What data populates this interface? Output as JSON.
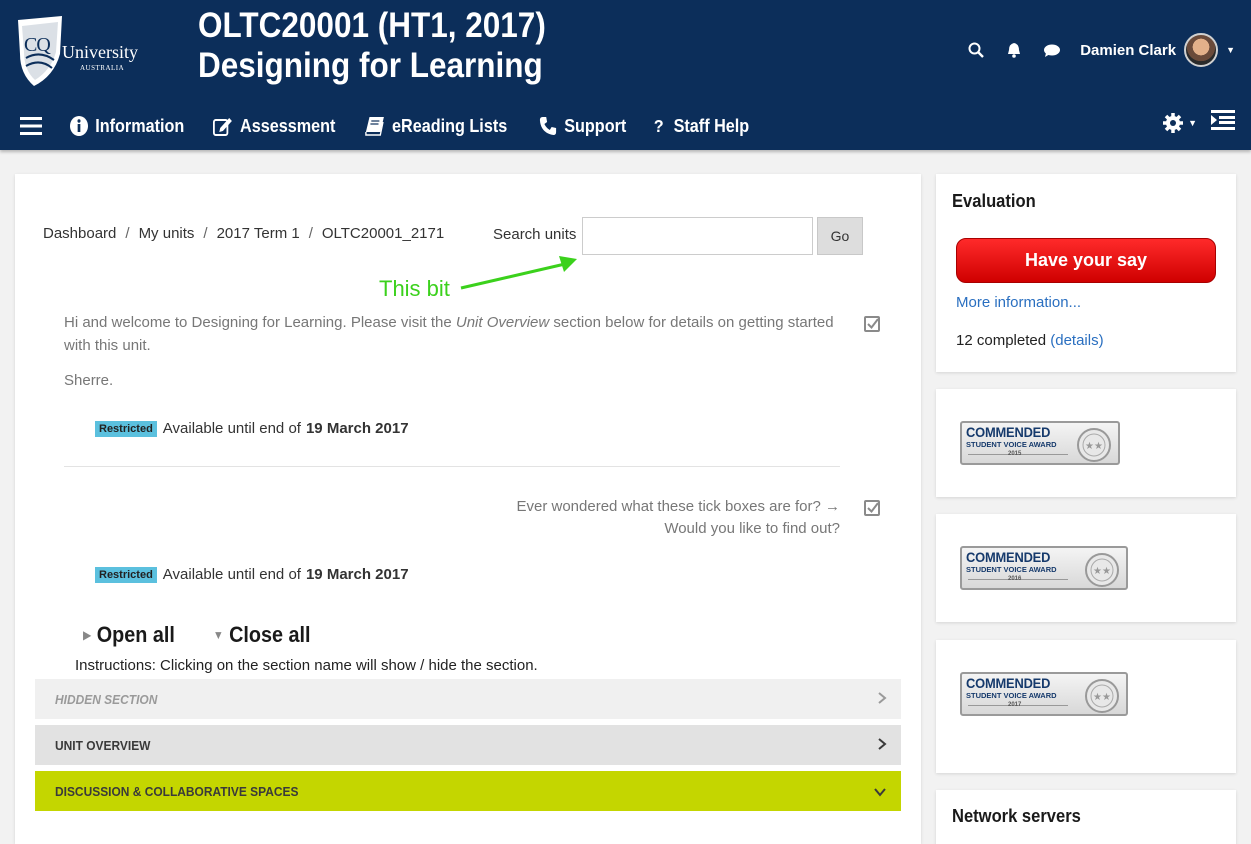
{
  "header": {
    "logo": {
      "cq": "CQ",
      "university": "University",
      "country": "AUSTRALIA"
    },
    "course_code": "OLTC20001 (HT1, 2017)",
    "course_title": "Designing for Learning",
    "user_name": "Damien Clark"
  },
  "nav": {
    "items": [
      {
        "label": "Information",
        "icon": "info-icon"
      },
      {
        "label": "Assessment",
        "icon": "edit-icon"
      },
      {
        "label": "eReading Lists",
        "icon": "book-icon"
      },
      {
        "label": "Support",
        "icon": "phone-icon"
      },
      {
        "label": "Staff Help",
        "icon": "question-icon"
      }
    ]
  },
  "breadcrumb": {
    "items": [
      "Dashboard",
      "My units",
      "2017 Term 1",
      "OLTC20001_2171"
    ],
    "separator": "/"
  },
  "search": {
    "label": "Search units",
    "value": "",
    "placeholder": "",
    "button": "Go"
  },
  "annotation": {
    "text": "This bit",
    "color": "#3bd11c"
  },
  "welcome": {
    "text_before": "Hi and welcome to Designing for Learning.  Please visit the ",
    "text_emphasis": "Unit Overview",
    "text_after": " section below for details on getting started with this unit.",
    "signoff": "Sherre."
  },
  "restrictions": [
    {
      "badge": "Restricted",
      "text": "Available until end of",
      "date": "19 March 2017"
    },
    {
      "badge": "Restricted",
      "text": "Available until end of",
      "date": "19 March 2017"
    }
  ],
  "tick_question": {
    "line1": "Ever wondered what these tick boxes are for? →",
    "line2": "Would you like to find out?"
  },
  "sections_controls": {
    "open_all": "Open all",
    "close_all": "Close all",
    "instructions": "Instructions: Clicking on the section name will show / hide the section."
  },
  "sections": [
    {
      "label": "HIDDEN SECTION",
      "state": "collapsed"
    },
    {
      "label": "UNIT OVERVIEW",
      "state": "collapsed"
    },
    {
      "label": "DISCUSSION & COLLABORATIVE SPACES",
      "state": "expanded"
    }
  ],
  "evaluation": {
    "title": "Evaluation",
    "button": "Have your say",
    "more_info": "More information...",
    "completed_text": "12 completed",
    "details_link": "(details)"
  },
  "awards": [
    {
      "title": "COMMENDED",
      "subtitle": "STUDENT VOICE AWARD",
      "year": "2015"
    },
    {
      "title": "COMMENDED",
      "subtitle": "STUDENT VOICE AWARD",
      "year": "2016"
    },
    {
      "title": "COMMENDED",
      "subtitle": "STUDENT VOICE AWARD",
      "year": "2017"
    }
  ],
  "network": {
    "title": "Network servers"
  },
  "colors": {
    "header_bg": "#0c2e5a",
    "section_active": "#c4d600",
    "badge": "#5bc0de",
    "primary_button": "#e00000",
    "link": "#2a6fc0"
  }
}
